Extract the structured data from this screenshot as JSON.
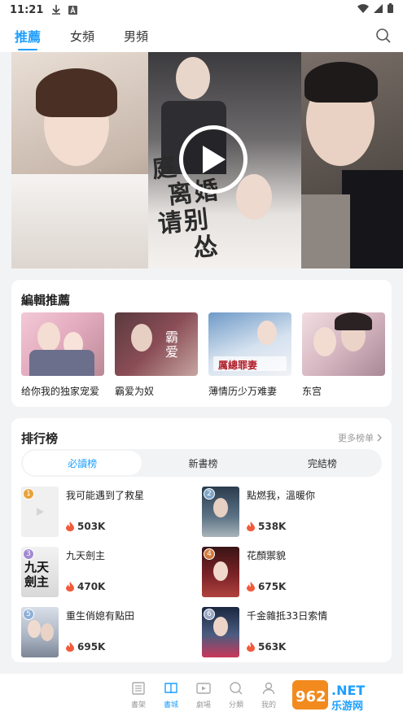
{
  "status_bar": {
    "time": "11:21"
  },
  "top_nav": {
    "tabs": [
      {
        "label": "推薦",
        "active": true
      },
      {
        "label": "女頻",
        "active": false
      },
      {
        "label": "男頻",
        "active": false
      }
    ]
  },
  "banner": {
    "title_lines": [
      "庭",
      "离婚",
      "请别",
      "怂"
    ]
  },
  "editor": {
    "title": "編輯推薦",
    "books": [
      {
        "title": "给你我的独家宠爱"
      },
      {
        "title": "霸爱为奴"
      },
      {
        "title": "薄情历少万难妻"
      },
      {
        "title": "东宫"
      }
    ]
  },
  "ranking": {
    "title": "排行榜",
    "more": "更多榜单",
    "tabs": [
      {
        "label": "必讀榜",
        "active": true
      },
      {
        "label": "新書榜",
        "active": false
      },
      {
        "label": "完結榜",
        "active": false
      }
    ],
    "items": [
      {
        "no": "1",
        "name": "我可能遇到了救星",
        "heat": "503K"
      },
      {
        "no": "2",
        "name": "點燃我，溫暖你",
        "heat": "538K"
      },
      {
        "no": "3",
        "name": "九天劍主",
        "heat": "470K"
      },
      {
        "no": "4",
        "name": "花顏禦貌",
        "heat": "675K"
      },
      {
        "no": "5",
        "name": "重生俏媳有點田",
        "heat": "695K"
      },
      {
        "no": "6",
        "name": "千金雜抵33日索情",
        "heat": "563K"
      }
    ]
  },
  "bottom_nav": [
    {
      "label": "書架",
      "active": false
    },
    {
      "label": "書城",
      "active": true
    },
    {
      "label": "劇場",
      "active": false
    },
    {
      "label": "分類",
      "active": false
    },
    {
      "label": "我的",
      "active": false
    }
  ],
  "colors": {
    "accent": "#1e9fff",
    "heat": "#f15a3a"
  },
  "watermark": "962.NET 乐游网"
}
